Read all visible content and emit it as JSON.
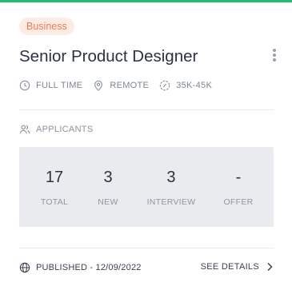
{
  "job": {
    "category": "Business",
    "title": "Senior Product Designer",
    "employment_type": "FULL TIME",
    "location": "REMOTE",
    "salary": "35K-45K"
  },
  "applicants": {
    "heading": "APPLICANTS",
    "stats": [
      {
        "value": "17",
        "label": "TOTAL"
      },
      {
        "value": "3",
        "label": "NEW"
      },
      {
        "value": "3",
        "label": "INTERVIEW"
      },
      {
        "value": "-",
        "label": "OFFER"
      }
    ]
  },
  "footer": {
    "published": "PUBLISHED - 12/09/2022",
    "details_label": "SEE DETAILS"
  },
  "icons": {
    "menu": "more-vertical-icon",
    "type": "clock-icon",
    "location": "map-pin-icon",
    "salary": "money-icon",
    "applicants": "users-icon",
    "published": "globe-icon",
    "details": "chevron-right-icon"
  },
  "colors": {
    "accent_top": "#1fbf73",
    "badge_bg": "#fdece6",
    "badge_text": "#ee7c54",
    "stats_bg": "#e9ebef"
  }
}
